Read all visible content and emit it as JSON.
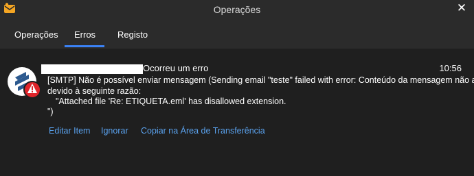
{
  "window": {
    "title": "Operações",
    "close_glyph": "✕",
    "app_icon": "app-logo-icon"
  },
  "tabs": [
    {
      "label": "Operações",
      "active": false
    },
    {
      "label": "Erros",
      "active": true
    },
    {
      "label": "Registo",
      "active": false
    }
  ],
  "error": {
    "icon": "error-warning-icon",
    "title": "Ocorreu um erro",
    "time": "10:56",
    "message_lines": [
      "[SMTP] Não é possível enviar mensagem (Sending email \"teste\" failed with error: Conteúdo da mensagem não aceito",
      "devido à seguinte razão:",
      "\"Attached file 'Re: ETIQUETA.eml' has disallowed extension.",
      "\")"
    ]
  },
  "actions": {
    "edit": "Editar Item",
    "ignore": "Ignorar",
    "copy": "Copiar na Área de Transferência"
  },
  "colors": {
    "background": "#1f1f1f",
    "header": "#2b2b2b",
    "accent": "#3b82f6",
    "link": "#5aa2ee",
    "error_red": "#e0252b"
  }
}
